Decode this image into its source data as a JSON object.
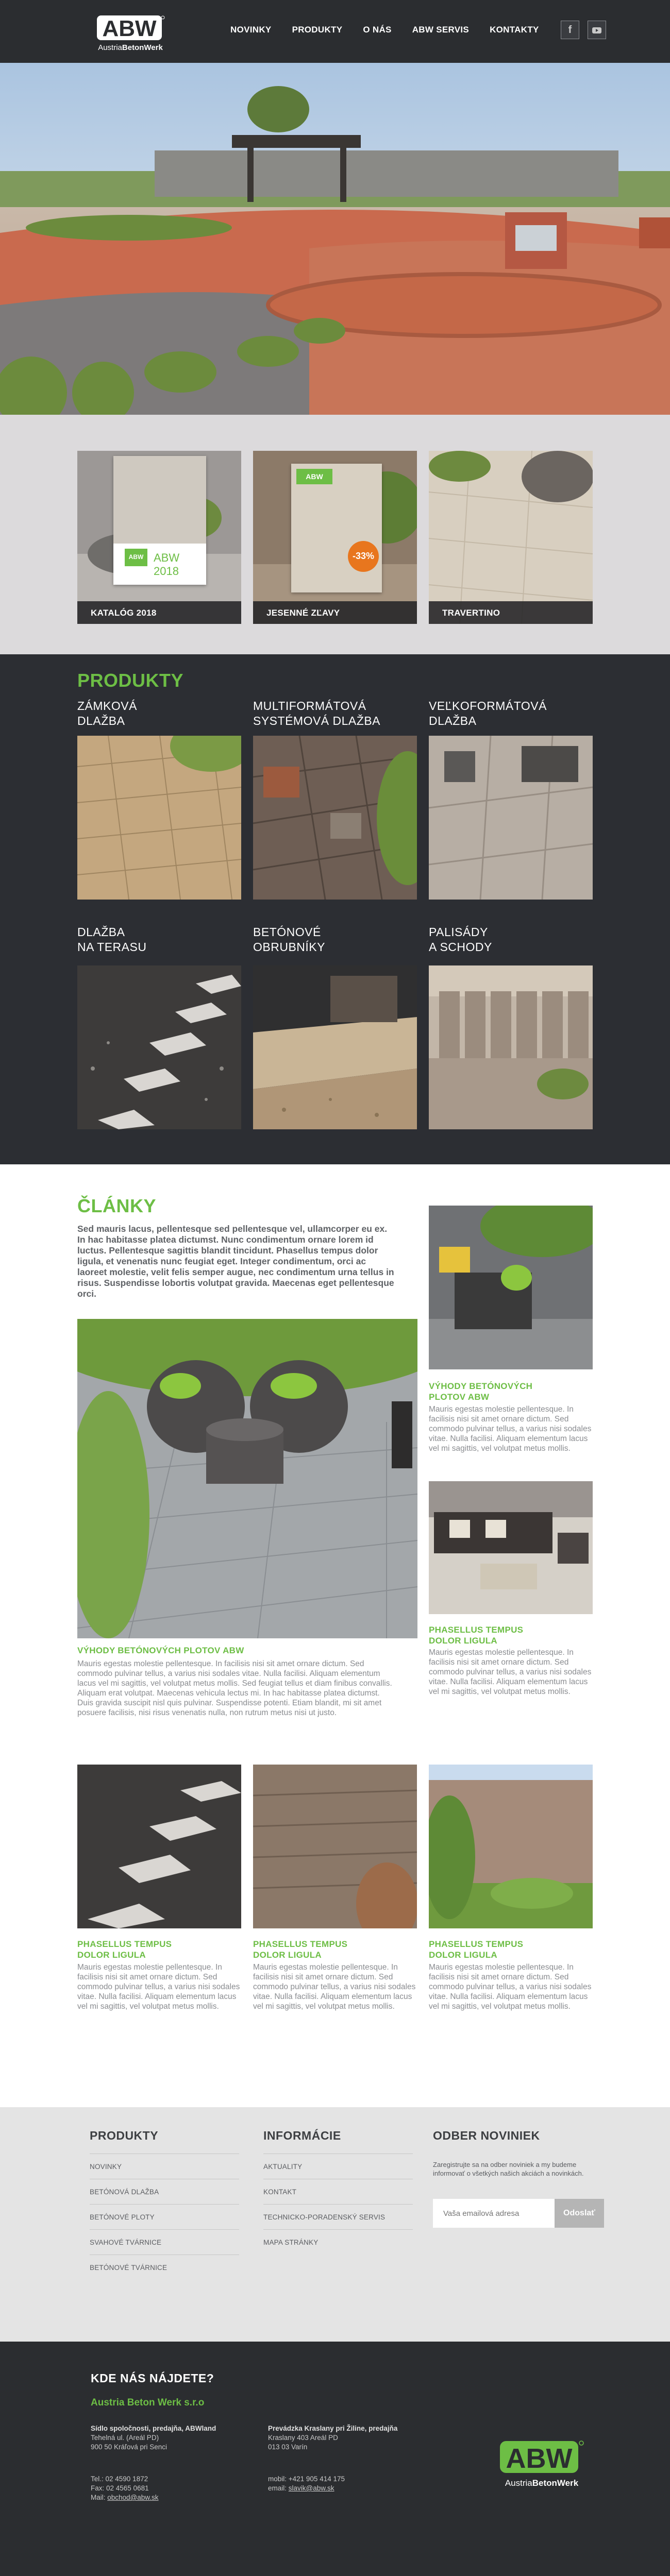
{
  "header": {
    "logo_text": "ABW",
    "logo_word_light": "Austria",
    "logo_word_bold": "BetonWerk",
    "nav": [
      "NOVINKY",
      "PRODUKTY",
      "O NÁS",
      "ABW SERVIS",
      "KONTAKTY"
    ],
    "social": {
      "facebook": "f",
      "youtube": "You"
    }
  },
  "promo": [
    {
      "caption": "KATALÓG 2018",
      "brochure_text": "ABW 2018"
    },
    {
      "caption": "JESENNÉ ZĽAVY",
      "brochure_text": "ABW",
      "badge": "-33%"
    },
    {
      "caption": "TRAVERTINO"
    }
  ],
  "products": {
    "title": "PRODUKTY",
    "items": [
      {
        "line1": "ZÁMKOVÁ",
        "line2": "DLAŽBA"
      },
      {
        "line1": "MULTIFORMÁTOVÁ",
        "line2": "SYSTÉMOVÁ DLAŽBA"
      },
      {
        "line1": "VEĽKOFORMÁTOVÁ",
        "line2": "DLAŽBA"
      },
      {
        "line1": "DLAŽBA",
        "line2": "NA TERASU"
      },
      {
        "line1": "BETÓNOVÉ",
        "line2": "OBRUBNÍKY"
      },
      {
        "line1": "PALISÁDY",
        "line2": "A SCHODY"
      }
    ]
  },
  "articles": {
    "title": "ČLÁNKY",
    "intro": "Sed mauris lacus, pellentesque sed pellentesque vel, ullamcorper eu ex. In hac habitasse platea dictumst. Nunc condimentum ornare lorem id luctus. Pellentesque sagittis blandit tincidunt. Phasellus tempus dolor ligula, et venenatis nunc feugiat eget. Integer condimentum, orci ac laoreet molestie, velit felis semper augue, nec condimentum urna tellus in risus. Suspendisse lobortis volutpat gravida. Maecenas eget pellentesque orci.",
    "main": {
      "title": "VÝHODY BETÓNOVÝCH PLOTOV ABW",
      "text": "Mauris egestas molestie pellentesque. In facilisis nisi sit amet ornare dictum. Sed commodo pulvinar tellus, a varius nisi sodales vitae. Nulla facilisi. Aliquam elementum lacus vel mi sagittis, vel volutpat metus mollis. Sed feugiat tellus et diam finibus convallis. Aliquam erat volutpat. Maecenas vehicula lectus mi. In hac habitasse platea dictumst. Duis gravida suscipit nisl quis pulvinar. Suspendisse potenti. Etiam blandit, mi sit amet posuere facilisis, nisi risus venenatis nulla, non rutrum metus nisi ut justo."
    },
    "side": [
      {
        "title1": "VÝHODY BETÓNOVÝCH",
        "title2": "PLOTOV ABW",
        "text": "Mauris egestas molestie pellentesque. In facilisis nisi sit amet ornare dictum. Sed commodo pulvinar tellus, a varius nisi sodales vitae. Nulla facilisi. Aliquam elementum lacus vel mi sagittis, vel volutpat metus mollis."
      },
      {
        "title1": "PHASELLUS TEMPUS",
        "title2": "DOLOR LIGULA",
        "text": "Mauris egestas molestie pellentesque. In facilisis nisi sit amet ornare dictum. Sed commodo pulvinar tellus, a varius nisi sodales vitae. Nulla facilisi. Aliquam elementum lacus vel mi sagittis, vel volutpat metus mollis."
      }
    ],
    "bottom": [
      {
        "title1": "PHASELLUS TEMPUS",
        "title2": "DOLOR LIGULA",
        "text": "Mauris egestas molestie pellentesque. In facilisis nisi sit amet ornare dictum. Sed commodo pulvinar tellus, a varius nisi sodales vitae. Nulla facilisi. Aliquam elementum lacus vel mi sagittis, vel volutpat metus mollis."
      },
      {
        "title1": "PHASELLUS TEMPUS",
        "title2": "DOLOR LIGULA",
        "text": "Mauris egestas molestie pellentesque. In facilisis nisi sit amet ornare dictum. Sed commodo pulvinar tellus, a varius nisi sodales vitae. Nulla facilisi. Aliquam elementum lacus vel mi sagittis, vel volutpat metus mollis."
      },
      {
        "title1": "PHASELLUS TEMPUS",
        "title2": "DOLOR LIGULA",
        "text": "Mauris egestas molestie pellentesque. In facilisis nisi sit amet ornare dictum. Sed commodo pulvinar tellus, a varius nisi sodales vitae. Nulla facilisi. Aliquam elementum lacus vel mi sagittis, vel volutpat metus mollis."
      }
    ]
  },
  "footer": {
    "produkty_title": "PRODUKTY",
    "produkty": [
      "NOVINKY",
      "BETÓNOVÁ DLAŽBA",
      "BETÓNOVÉ PLOTY",
      "SVAHOVÉ TVÁRNICE",
      "BETÓNOVÉ TVÁRNICE"
    ],
    "info_title": "INFORMÁCIE",
    "info": [
      "AKTUALITY",
      "KONTAKT",
      "TECHNICKO-PORADENSKÝ SERVIS",
      "MAPA STRÁNKY"
    ],
    "newsletter_title": "ODBER NOVINIEK",
    "newsletter_text": "Zaregistrujte sa na odber noviniek a my budeme informovať o všetkých našich akciách a novinkách.",
    "newsletter_placeholder": "Vaša emailová adresa",
    "newsletter_button": "Odoslať"
  },
  "contact": {
    "title": "KDE NÁS NÁJDETE?",
    "company": "Austria Beton Werk s.r.o",
    "left_head": "Sídlo spoločnosti, predajňa, ABWland",
    "left_addr1": "Tehelná ul. (Areál PD)",
    "left_addr2": "900 50 Kráľová pri Senci",
    "left_tel": "Tel.: 02 4590 1872",
    "left_fax": "Fax: 02 4565 0681",
    "left_mail_label": "Mail: ",
    "left_mail": "obchod@abw.sk",
    "right_head": "Prevádzka Kraslany pri Žiline, predajňa",
    "right_addr1": "Kraslany 403 Areál PD",
    "right_addr2": "013 03 Varín",
    "right_tel": "mobil: +421 905 414 175",
    "right_mail_label": "email: ",
    "right_mail": "slavik@abw.sk",
    "logo_text": "ABW",
    "logo_word_light": "Austria",
    "logo_word_bold": "BetonWerk"
  },
  "colors": {
    "accent": "#6dbe45",
    "header_bg": "#2b2d30",
    "products_bg": "#2c2e33",
    "promo_bg": "#dcdadc"
  }
}
